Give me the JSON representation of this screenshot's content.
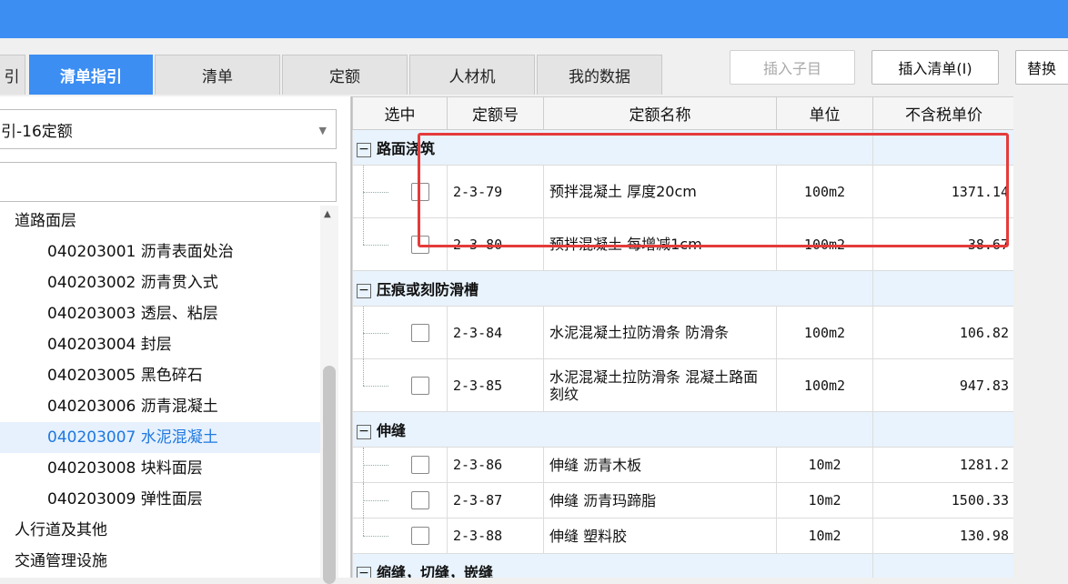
{
  "tabs": [
    {
      "label": "引",
      "active": false
    },
    {
      "label": "清单指引",
      "active": true
    },
    {
      "label": "清单",
      "active": false
    },
    {
      "label": "定额",
      "active": false
    },
    {
      "label": "人材机",
      "active": false
    },
    {
      "label": "我的数据",
      "active": false
    }
  ],
  "toolbar": {
    "insert_child_label": "插入子目",
    "insert_list_label": "插入清单(I)",
    "replace_label": "替换"
  },
  "left_panel": {
    "dropdown_value": "引-16定额",
    "search_value": "",
    "tree": [
      {
        "label": "道路面层",
        "level": 0,
        "selected": false
      },
      {
        "label": "040203001  沥青表面处治",
        "level": 1,
        "selected": false
      },
      {
        "label": "040203002  沥青贯入式",
        "level": 1,
        "selected": false
      },
      {
        "label": "040203003  透层、粘层",
        "level": 1,
        "selected": false
      },
      {
        "label": "040203004  封层",
        "level": 1,
        "selected": false
      },
      {
        "label": "040203005  黑色碎石",
        "level": 1,
        "selected": false
      },
      {
        "label": "040203006  沥青混凝土",
        "level": 1,
        "selected": false
      },
      {
        "label": "040203007  水泥混凝土",
        "level": 1,
        "selected": true
      },
      {
        "label": "040203008  块料面层",
        "level": 1,
        "selected": false
      },
      {
        "label": "040203009  弹性面层",
        "level": 1,
        "selected": false
      },
      {
        "label": "人行道及其他",
        "level": 0,
        "selected": false
      },
      {
        "label": "交通管理设施",
        "level": 0,
        "selected": false
      }
    ]
  },
  "grid": {
    "headers": {
      "select": "选中",
      "code": "定额号",
      "name": "定额名称",
      "unit": "单位",
      "price": "不含税单价"
    },
    "groups": [
      {
        "title": "路面浇筑",
        "rows": [
          {
            "code": "2-3-79",
            "name": "预拌混凝土 厚度20cm",
            "unit": "100m2",
            "price": "1371.14"
          },
          {
            "code": "2-3-80",
            "name": "预拌混凝土 每增减1cm",
            "unit": "100m2",
            "price": "38.67"
          }
        ]
      },
      {
        "title": "压痕或刻防滑槽",
        "rows": [
          {
            "code": "2-3-84",
            "name": "水泥混凝土拉防滑条 防滑条",
            "unit": "100m2",
            "price": "106.82"
          },
          {
            "code": "2-3-85",
            "name": "水泥混凝土拉防滑条 混凝土路面刻纹",
            "unit": "100m2",
            "price": "947.83"
          }
        ]
      },
      {
        "title": "伸缝",
        "rows": [
          {
            "code": "2-3-86",
            "name": "伸缝 沥青木板",
            "unit": "10m2",
            "price": "1281.2"
          },
          {
            "code": "2-3-87",
            "name": "伸缝 沥青玛蹄脂",
            "unit": "10m2",
            "price": "1500.33"
          },
          {
            "code": "2-3-88",
            "name": "伸缝 塑料胶",
            "unit": "10m2",
            "price": "130.98"
          }
        ]
      },
      {
        "title": "缩缝，切缝，嵌缝",
        "rows": []
      }
    ],
    "expander_symbol": "−"
  },
  "colors": {
    "accent": "#3c8ef3",
    "highlight_box": "#e53b3b",
    "group_bg": "#e8f3fd",
    "selected_text": "#1f78e0"
  }
}
